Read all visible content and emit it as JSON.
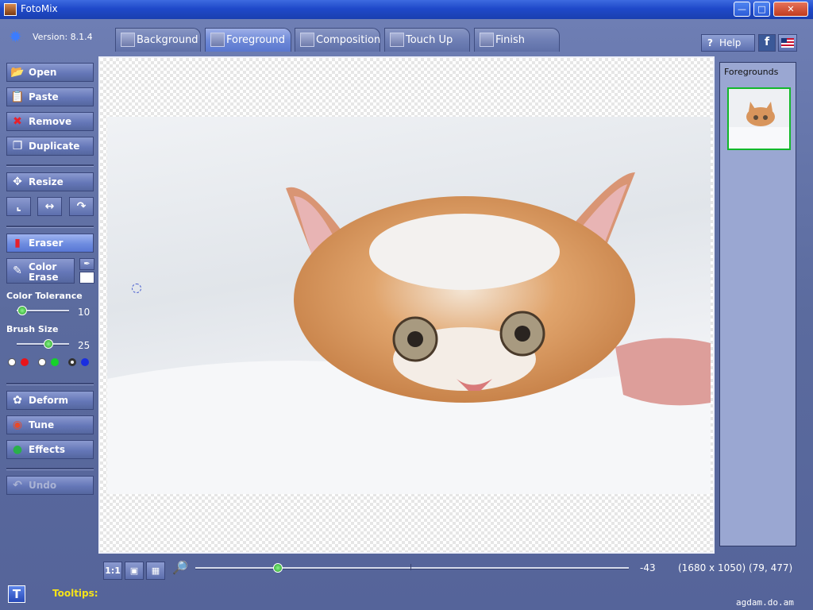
{
  "window": {
    "title": "FotoMix"
  },
  "app": {
    "version": "Version: 8.1.4"
  },
  "tabs": [
    {
      "label": "Background"
    },
    {
      "label": "Foreground"
    },
    {
      "label": "Composition"
    },
    {
      "label": "Touch Up"
    },
    {
      "label": "Finish"
    }
  ],
  "header": {
    "help_label": "Help"
  },
  "sidebar": {
    "open": "Open",
    "paste": "Paste",
    "remove": "Remove",
    "duplicate": "Duplicate",
    "resize": "Resize",
    "eraser": "Eraser",
    "color_erase_line1": "Color",
    "color_erase_line2": "Erase",
    "color_tolerance_label": "Color Tolerance",
    "color_tolerance_value": "10",
    "brush_size_label": "Brush Size",
    "brush_size_value": "25",
    "deform": "Deform",
    "tune": "Tune",
    "effects": "Effects",
    "undo": "Undo"
  },
  "sliders": {
    "color_tolerance_level": 0.1,
    "brush_size_level": 0.6,
    "zoom_level": 0.19
  },
  "colors": {
    "accent_green": "#12b82b",
    "tooltips_yellow": "#f4e21a",
    "dot_red": "#e8141a",
    "dot_green": "#15d22a",
    "dot_blue": "#1a2ee0"
  },
  "right_panel": {
    "title": "Foregrounds"
  },
  "bottom": {
    "btn_11": "1:1",
    "zoom_value": "-43",
    "coords": "(1680 x 1050) (79, 477)"
  },
  "footer": {
    "tooltips": "Tooltips:",
    "tooltips_btn": "T",
    "watermark": "agdam.do.am"
  }
}
